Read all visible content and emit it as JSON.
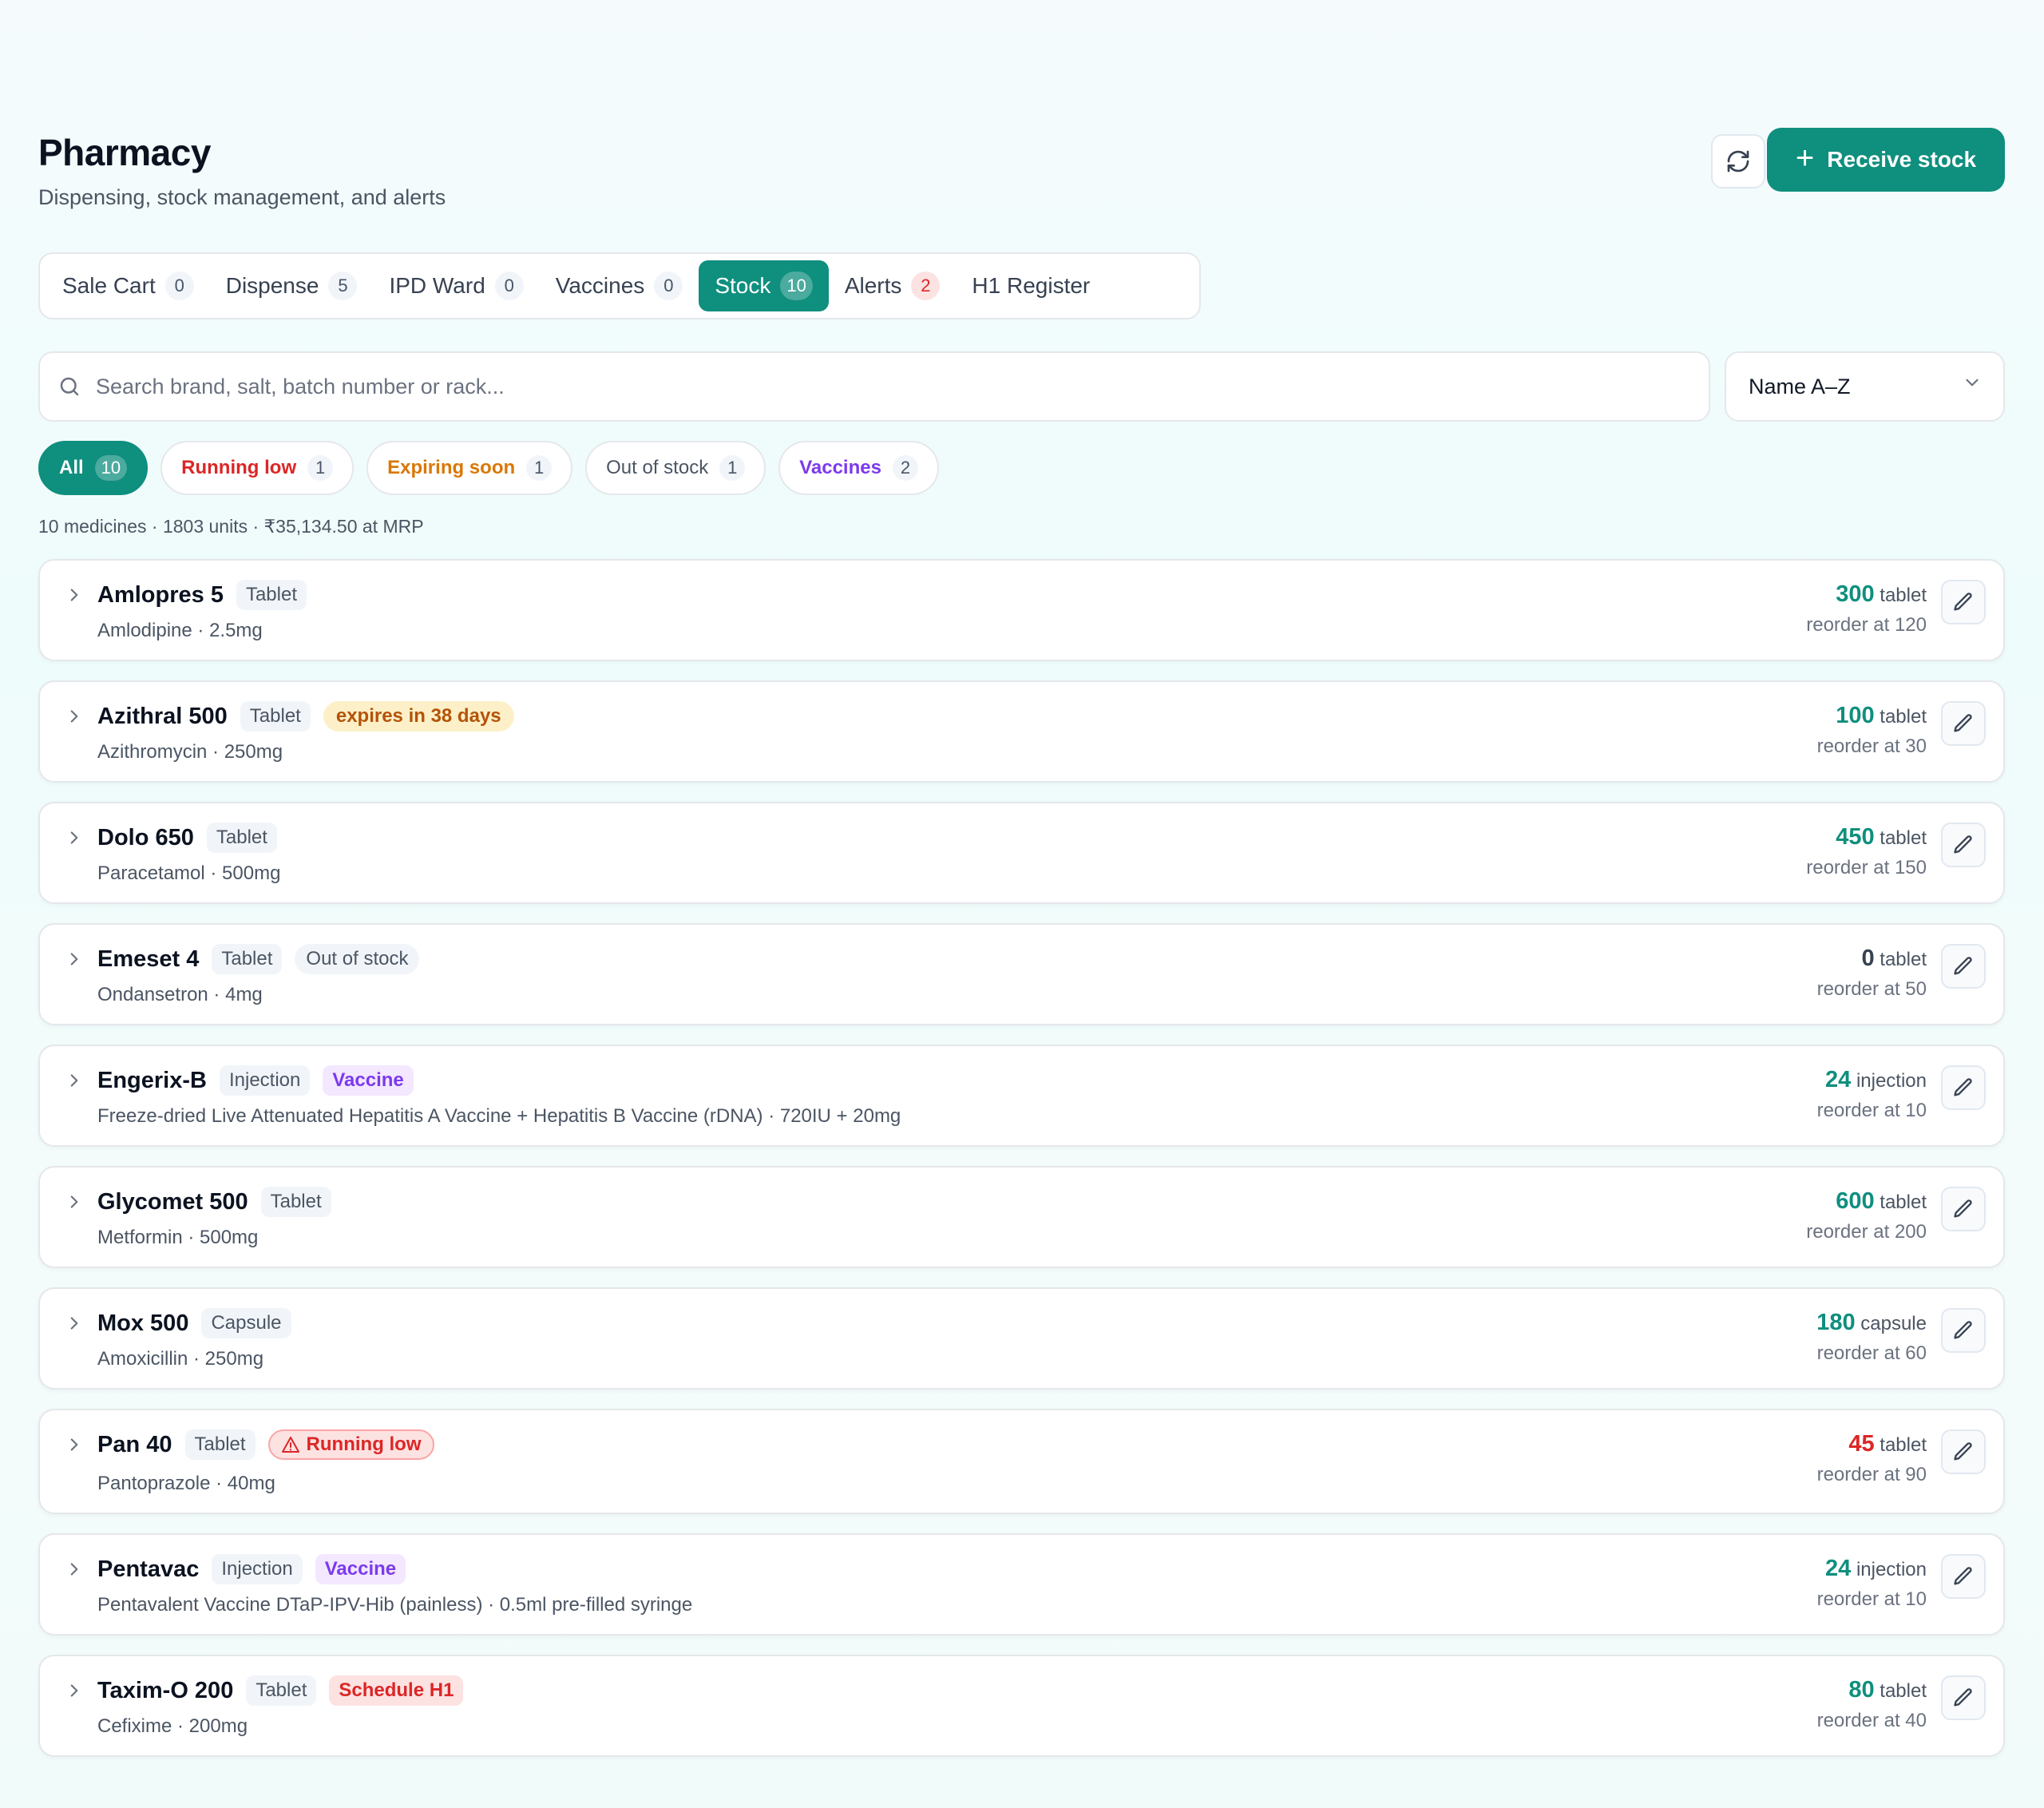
{
  "header": {
    "title": "Pharmacy",
    "subtitle": "Dispensing, stock management, and alerts",
    "receive_label": "Receive stock",
    "refresh_icon": "refresh-icon",
    "plus_icon": "plus-icon"
  },
  "tabs": [
    {
      "label": "Sale Cart",
      "count": "0",
      "active": false
    },
    {
      "label": "Dispense",
      "count": "5",
      "active": false
    },
    {
      "label": "IPD Ward",
      "count": "0",
      "active": false
    },
    {
      "label": "Vaccines",
      "count": "0",
      "active": false
    },
    {
      "label": "Stock",
      "count": "10",
      "active": true
    },
    {
      "label": "Alerts",
      "count": "2",
      "active": false
    },
    {
      "label": "H1 Register",
      "count": "",
      "active": false
    }
  ],
  "search": {
    "placeholder": "Search brand, salt, batch number or rack...",
    "icon": "search-icon"
  },
  "sort": {
    "value": "Name A–Z"
  },
  "filters": [
    {
      "label": "All",
      "count": "10"
    },
    {
      "label": "Running low",
      "count": "1"
    },
    {
      "label": "Expiring soon",
      "count": "1"
    },
    {
      "label": "Out of stock",
      "count": "1"
    },
    {
      "label": "Vaccines",
      "count": "2"
    }
  ],
  "summary": "10 medicines · 1803 units · ₹35,134.50 at MRP",
  "medicines": [
    {
      "name": "Amlopres 5",
      "form": "Tablet",
      "salt": "Amlodipine · 2.5mg",
      "qty": "300",
      "unit": "tablet",
      "reorder": "reorder at 120"
    },
    {
      "name": "Azithral 500",
      "form": "Tablet",
      "badge": "expires in 38 days",
      "salt": "Azithromycin · 250mg",
      "qty": "100",
      "unit": "tablet",
      "reorder": "reorder at 30"
    },
    {
      "name": "Dolo 650",
      "form": "Tablet",
      "salt": "Paracetamol · 500mg",
      "qty": "450",
      "unit": "tablet",
      "reorder": "reorder at 150"
    },
    {
      "name": "Emeset 4",
      "form": "Tablet",
      "badge": "Out of stock",
      "salt": "Ondansetron · 4mg",
      "qty": "0",
      "unit": "tablet",
      "reorder": "reorder at 50"
    },
    {
      "name": "Engerix-B",
      "form": "Injection",
      "badge": "Vaccine",
      "salt": "Freeze-dried Live Attenuated Hepatitis A Vaccine + Hepatitis B Vaccine (rDNA) · 720IU + 20mg",
      "qty": "24",
      "unit": "injection",
      "reorder": "reorder at 10"
    },
    {
      "name": "Glycomet 500",
      "form": "Tablet",
      "salt": "Metformin · 500mg",
      "qty": "600",
      "unit": "tablet",
      "reorder": "reorder at 200"
    },
    {
      "name": "Mox 500",
      "form": "Capsule",
      "salt": "Amoxicillin · 250mg",
      "qty": "180",
      "unit": "capsule",
      "reorder": "reorder at 60"
    },
    {
      "name": "Pan 40",
      "form": "Tablet",
      "badge": "Running low",
      "salt": "Pantoprazole · 40mg",
      "qty": "45",
      "unit": "tablet",
      "reorder": "reorder at 90"
    },
    {
      "name": "Pentavac",
      "form": "Injection",
      "badge": "Vaccine",
      "salt": "Pentavalent Vaccine DTaP-IPV-Hib (painless) · 0.5ml pre-filled syringe",
      "qty": "24",
      "unit": "injection",
      "reorder": "reorder at 10"
    },
    {
      "name": "Taxim-O 200",
      "form": "Tablet",
      "badge": "Schedule H1",
      "salt": "Cefixime · 200mg",
      "qty": "80",
      "unit": "tablet",
      "reorder": "reorder at 40"
    }
  ],
  "colors": {
    "accent": "#0f8f7e",
    "danger": "#dc2626",
    "warning": "#d97706",
    "vaccine": "#7c3aed"
  }
}
